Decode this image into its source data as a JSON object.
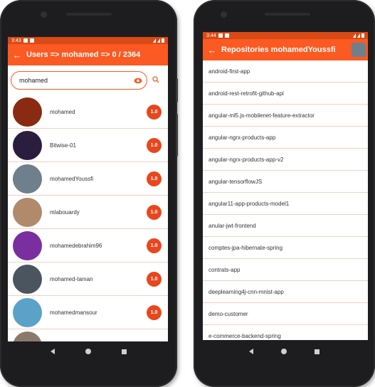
{
  "left_screen": {
    "status": {
      "time": "3:43"
    },
    "appbar": {
      "back_icon": "arrow-left-icon",
      "title": "Users => mohamed => 0 / 2364"
    },
    "search": {
      "value": "mohamed",
      "placeholder": "",
      "eye_icon": "eye-icon",
      "search_icon": "search-icon"
    },
    "users": [
      {
        "login": "mohamed",
        "score": "1.0",
        "avatar_color": "#8a2a12"
      },
      {
        "login": "Bitwise-01",
        "score": "1.0",
        "avatar_color": "#2b1d3d"
      },
      {
        "login": "mohamedYoussfi",
        "score": "1.0",
        "avatar_color": "#6f7f8c"
      },
      {
        "login": "mlabouardy",
        "score": "1.0",
        "avatar_color": "#b08a6a"
      },
      {
        "login": "mohamedebrahim96",
        "score": "1.0",
        "avatar_color": "#7a2fa0"
      },
      {
        "login": "mohamed-taman",
        "score": "1.0",
        "avatar_color": "#4a5560"
      },
      {
        "login": "mohamedmansour",
        "score": "1.0",
        "avatar_color": "#5aa2c8"
      },
      {
        "login": "",
        "score": "",
        "avatar_color": "#8a7a6a"
      }
    ]
  },
  "right_screen": {
    "status": {
      "time": "3:44"
    },
    "appbar": {
      "back_icon": "arrow-left-icon",
      "title": "Repositories mohamedYoussfi"
    },
    "repositories": [
      "android-first-app",
      "android-rest-retrofit-github-api",
      "angular-ml5.js-mobilenet-feature-extractor",
      "angular-ngrx-products-app",
      "angular-ngrx-products-app-v2",
      "angular-tensorflowJS",
      "angular11-app-products-model1",
      "anular-jwt-frontend",
      "comptes-jpa-hibernate-spring",
      "contrats-app",
      "deeplearning4j-cnn-mnist-app",
      "demo-customer",
      "e-commerce-backend-spring"
    ]
  },
  "colors": {
    "accent": "#fb5a22",
    "statusbar": "#d84a16",
    "badge": "#e8471d",
    "divider": "#f3cfc3"
  },
  "nav_icons": [
    "back-triangle-icon",
    "home-circle-icon",
    "recents-square-icon"
  ]
}
